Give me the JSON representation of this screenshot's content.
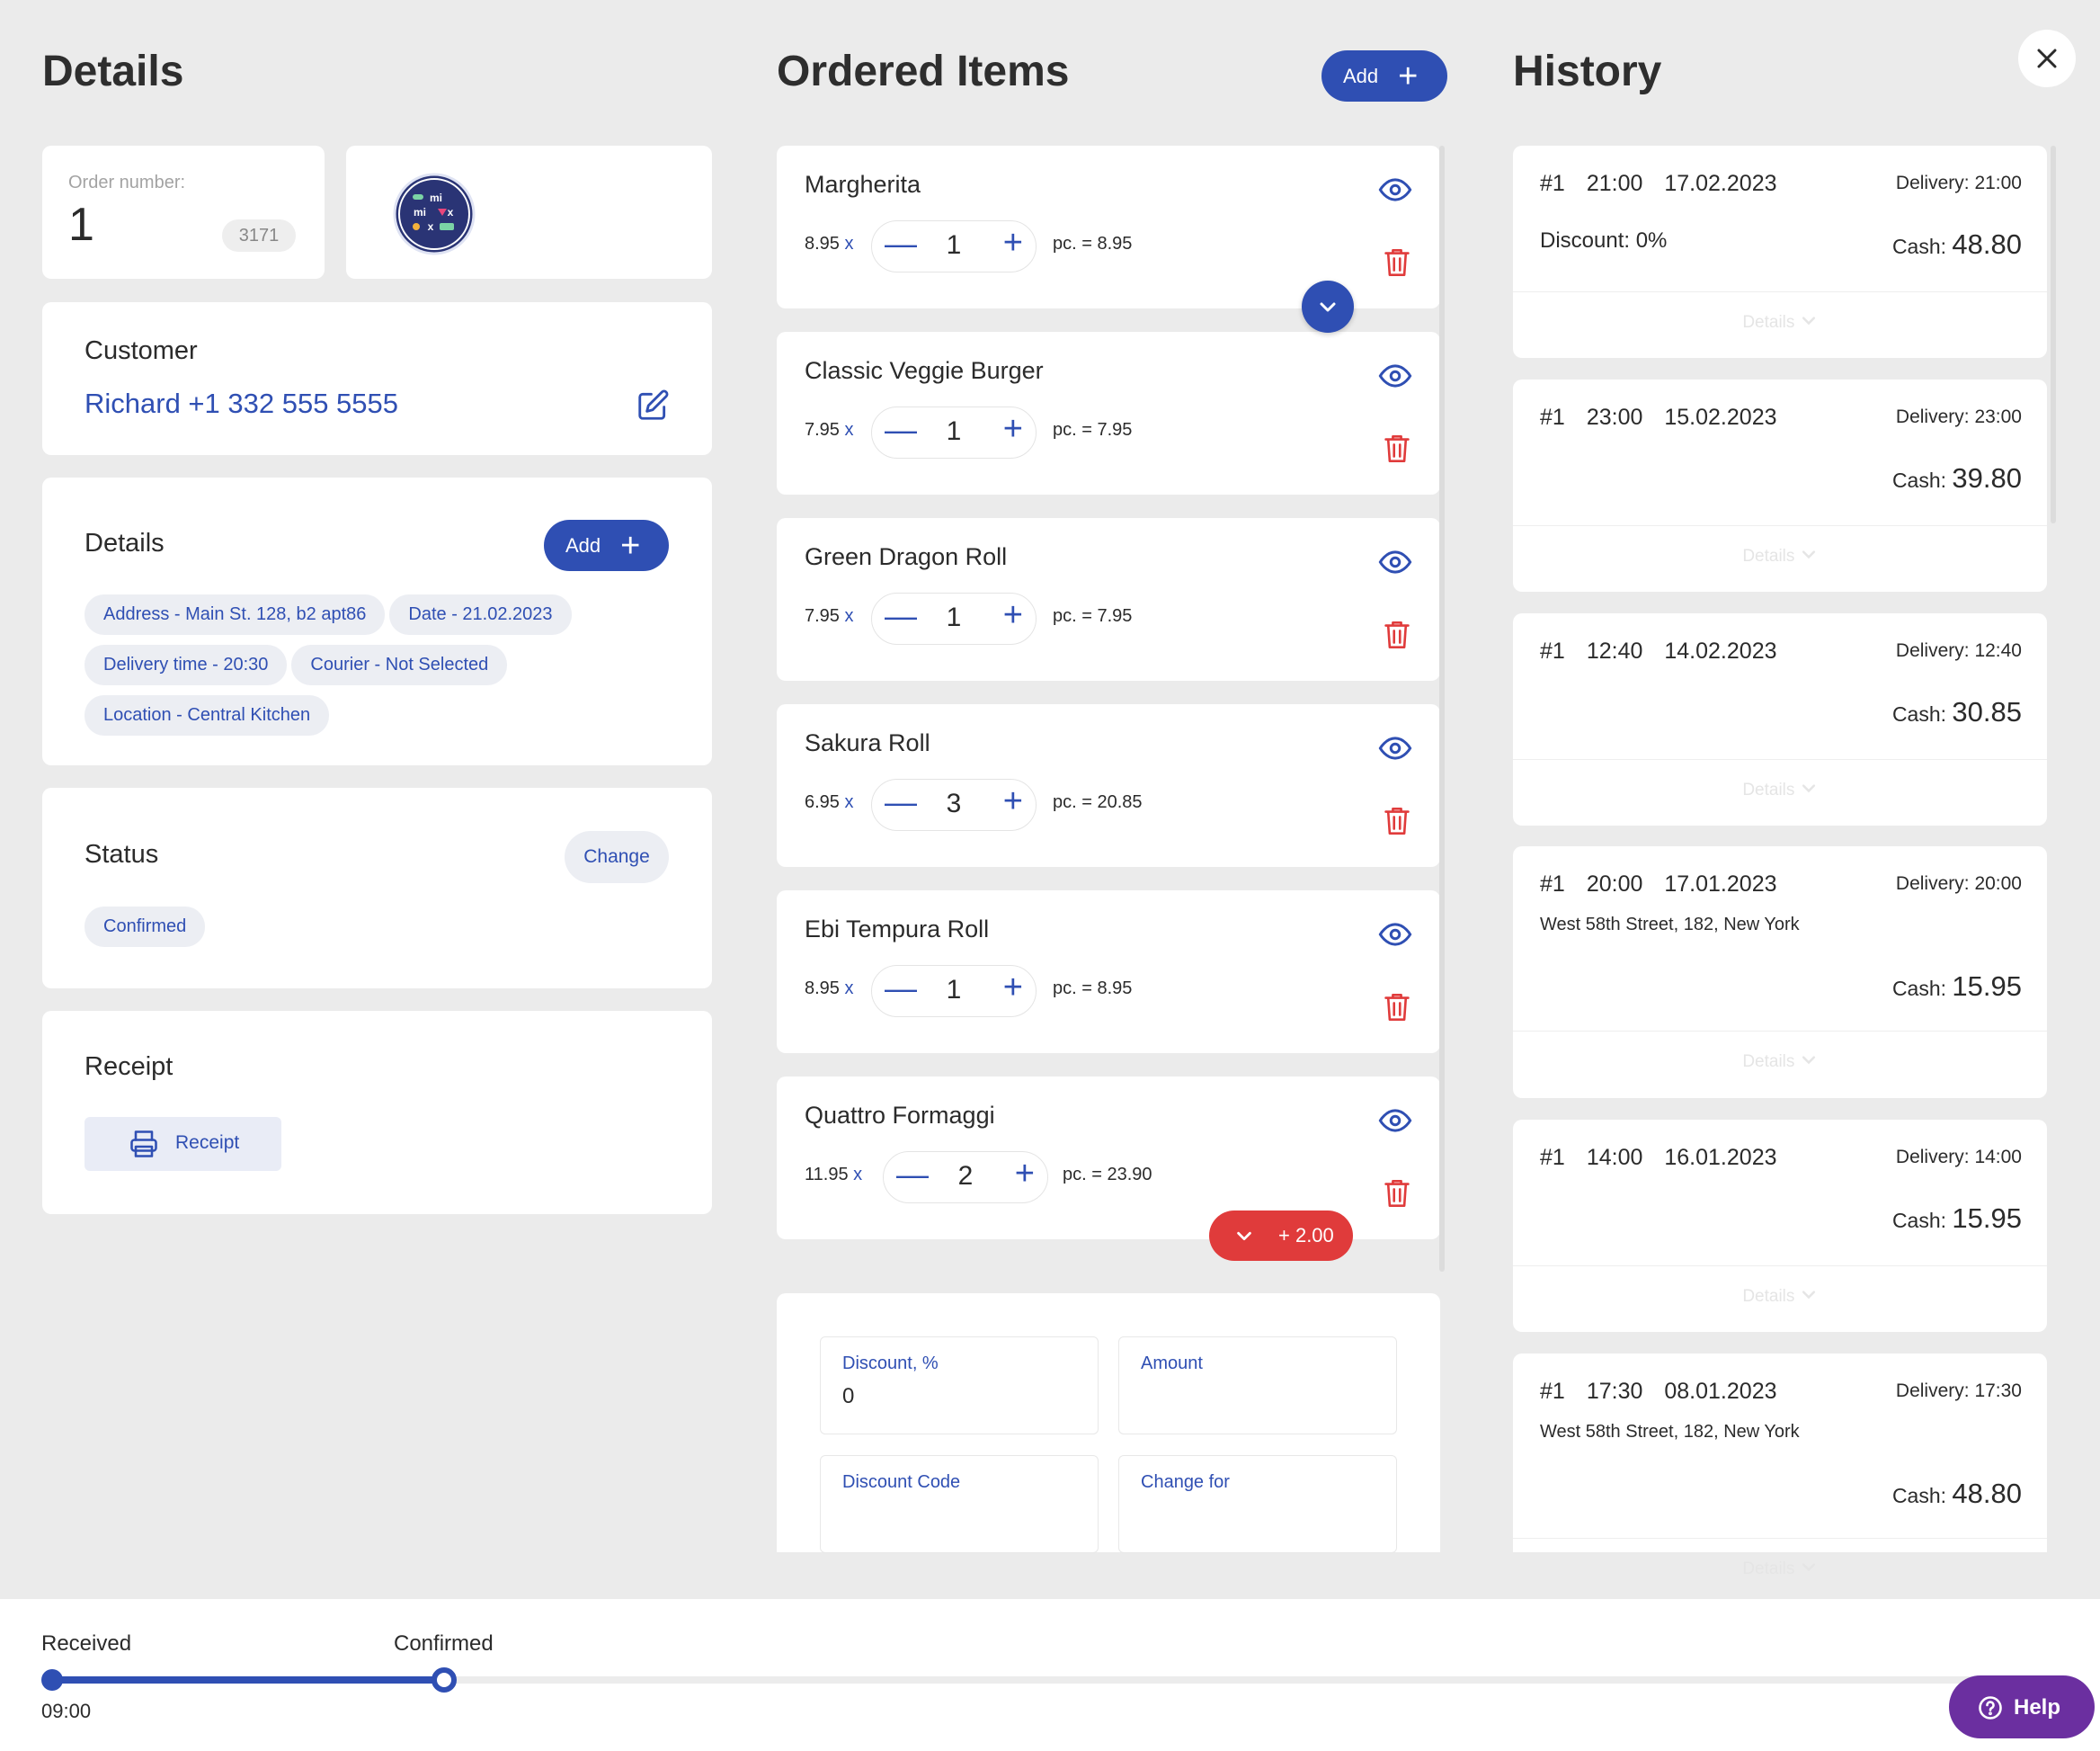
{
  "details_panel": {
    "title": "Details",
    "order": {
      "label": "Order number:",
      "number": "1",
      "code": "3171"
    },
    "logo_text": "mi mi x",
    "customer": {
      "title": "Customer",
      "value": "Richard +1 332 555 5555"
    },
    "details": {
      "title": "Details",
      "add_label": "Add",
      "chips": [
        "Address - Main St. 128, b2 apt86",
        "Date - 21.02.2023",
        "Delivery time - 20:30",
        "Courier - Not Selected",
        "Location - Central Kitchen"
      ]
    },
    "status": {
      "title": "Status",
      "change_label": "Change",
      "value": "Confirmed"
    },
    "receipt": {
      "title": "Receipt",
      "button_label": "Receipt"
    }
  },
  "ordered_items": {
    "title": "Ordered Items",
    "add_label": "Add",
    "items": [
      {
        "name": "Margherita",
        "price": "8.95",
        "x": "x",
        "qty": "1",
        "total": "pc. = 8.95"
      },
      {
        "name": "Classic Veggie Burger",
        "price": "7.95",
        "x": "x",
        "qty": "1",
        "total": "pc. = 7.95"
      },
      {
        "name": "Green Dragon Roll",
        "price": "7.95",
        "x": "x",
        "qty": "1",
        "total": "pc. = 7.95"
      },
      {
        "name": "Sakura Roll",
        "price": "6.95",
        "x": "x",
        "qty": "3",
        "total": "pc. = 20.85"
      },
      {
        "name": "Ebi Tempura Roll",
        "price": "8.95",
        "x": "x",
        "qty": "1",
        "total": "pc. = 8.95"
      },
      {
        "name": "Quattro Formaggi",
        "price": "11.95",
        "x": "x",
        "qty": "2",
        "total": "pc. = 23.90"
      }
    ],
    "extra_badge": "+ 2.00",
    "fields": {
      "discount_label": "Discount, %",
      "discount_value": "0",
      "amount_label": "Amount",
      "code_label": "Discount Code",
      "change_label": "Change for"
    }
  },
  "history": {
    "title": "History",
    "entries": [
      {
        "num": "#1",
        "time": "21:00",
        "date": "17.02.2023",
        "delivery": "Delivery: 21:00",
        "extra": "Discount: 0%",
        "cash_label": "Cash:",
        "cash": "48.80",
        "details": "Details"
      },
      {
        "num": "#1",
        "time": "23:00",
        "date": "15.02.2023",
        "delivery": "Delivery: 23:00",
        "extra": "",
        "cash_label": "Cash:",
        "cash": "39.80",
        "details": "Details"
      },
      {
        "num": "#1",
        "time": "12:40",
        "date": "14.02.2023",
        "delivery": "Delivery: 12:40",
        "extra": "",
        "cash_label": "Cash:",
        "cash": "30.85",
        "details": "Details"
      },
      {
        "num": "#1",
        "time": "20:00",
        "date": "17.01.2023",
        "delivery": "Delivery: 20:00",
        "extra": "West 58th Street, 182, New York",
        "cash_label": "Cash:",
        "cash": "15.95",
        "details": "Details"
      },
      {
        "num": "#1",
        "time": "14:00",
        "date": "16.01.2023",
        "delivery": "Delivery: 14:00",
        "extra": "",
        "cash_label": "Cash:",
        "cash": "15.95",
        "details": "Details"
      },
      {
        "num": "#1",
        "time": "17:30",
        "date": "08.01.2023",
        "delivery": "Delivery: 17:30",
        "extra": "West 58th Street, 182, New York",
        "cash_label": "Cash:",
        "cash": "48.80",
        "details": "Details"
      }
    ]
  },
  "progress": {
    "received": "Received",
    "confirmed": "Confirmed",
    "time": "09:00"
  },
  "help_label": "Help",
  "colors": {
    "accent": "#2f4fb3",
    "danger": "#e03b3b",
    "help": "#6b2fa0"
  }
}
